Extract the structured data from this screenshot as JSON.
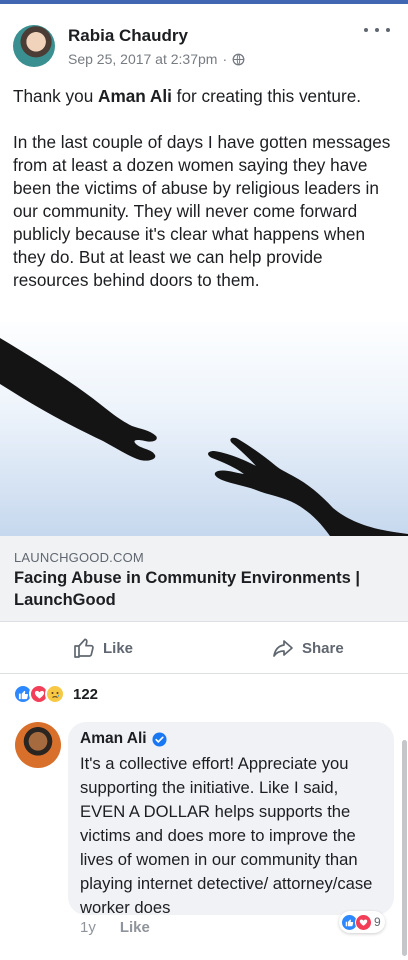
{
  "post": {
    "author": "Rabia Chaudry",
    "timestamp": "Sep 25, 2017 at 2:37pm",
    "separator": "·",
    "privacy_icon": "globe-icon",
    "text_intro_1": "Thank you ",
    "text_mention": "Aman Ali",
    "text_intro_2": " for creating this venture.",
    "text_body": "In the last couple of days I have gotten messages from at least a dozen women saying they have been the victims of abuse by religious leaders in our community. They will never come forward publicly because it's clear what happens when they do. But at least we can help provide resources behind doors to them."
  },
  "link": {
    "domain": "LAUNCHGOOD.COM",
    "title": "Facing Abuse in Community Environments | LaunchGood"
  },
  "actions": {
    "like_label": "Like",
    "share_label": "Share"
  },
  "reactions": {
    "types": [
      "like",
      "love",
      "sad"
    ],
    "count": "122"
  },
  "comment": {
    "author": "Aman Ali",
    "verified_icon": "verified-badge-icon",
    "text": "It's a collective effort! Appreciate you supporting the initiative.  Like I said, EVEN A DOLLAR helps supports the victims and does more to improve the lives of women in our community than playing internet detective/ attorney/case worker does",
    "age": "1y",
    "like_label": "Like",
    "reaction_types": [
      "like",
      "love"
    ],
    "reaction_count": "9"
  },
  "colors": {
    "facebook_blue": "#4267b2",
    "like_blue": "#2d88ff",
    "love_red": "#f33e58",
    "sad_yellow": "#f7c844",
    "secondary_text": "#606770"
  }
}
